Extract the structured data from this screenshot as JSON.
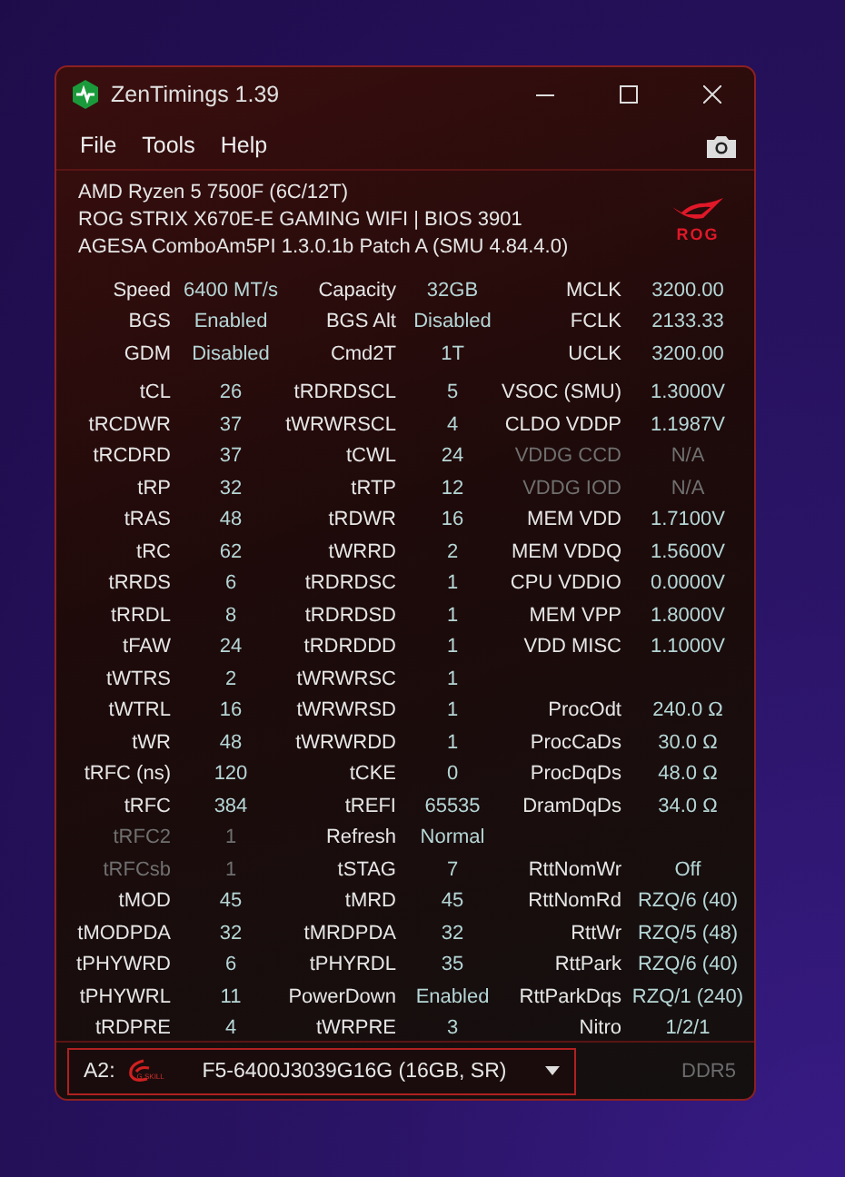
{
  "window": {
    "title": "ZenTimings 1.39"
  },
  "menu": [
    "File",
    "Tools",
    "Help"
  ],
  "system_info": [
    "AMD Ryzen 5 7500F (6C/12T)",
    "ROG STRIX X670E-E GAMING WIFI | BIOS 3901",
    "AGESA ComboAm5PI 1.3.0.1b Patch A (SMU 4.84.4.0)"
  ],
  "brand_logo": {
    "text": "ROG"
  },
  "groups": [
    [
      [
        {
          "label": "Speed",
          "value": "6400 MT/s",
          "disabled": false
        },
        {
          "label": "Capacity",
          "value": "32GB",
          "disabled": false
        },
        {
          "label": "MCLK",
          "value": "3200.00",
          "disabled": false
        }
      ],
      [
        {
          "label": "BGS",
          "value": "Enabled",
          "disabled": false
        },
        {
          "label": "BGS Alt",
          "value": "Disabled",
          "disabled": false
        },
        {
          "label": "FCLK",
          "value": "2133.33",
          "disabled": false
        }
      ],
      [
        {
          "label": "GDM",
          "value": "Disabled",
          "disabled": false
        },
        {
          "label": "Cmd2T",
          "value": "1T",
          "disabled": false
        },
        {
          "label": "UCLK",
          "value": "3200.00",
          "disabled": false
        }
      ]
    ],
    [
      [
        {
          "label": "tCL",
          "value": "26",
          "disabled": false
        },
        {
          "label": "tRDRDSCL",
          "value": "5",
          "disabled": false
        },
        {
          "label": "VSOC (SMU)",
          "value": "1.3000V",
          "disabled": false
        }
      ],
      [
        {
          "label": "tRCDWR",
          "value": "37",
          "disabled": false
        },
        {
          "label": "tWRWRSCL",
          "value": "4",
          "disabled": false
        },
        {
          "label": "CLDO VDDP",
          "value": "1.1987V",
          "disabled": false
        }
      ],
      [
        {
          "label": "tRCDRD",
          "value": "37",
          "disabled": false
        },
        {
          "label": "tCWL",
          "value": "24",
          "disabled": false
        },
        {
          "label": "VDDG CCD",
          "value": "N/A",
          "disabled": true
        }
      ],
      [
        {
          "label": "tRP",
          "value": "32",
          "disabled": false
        },
        {
          "label": "tRTP",
          "value": "12",
          "disabled": false
        },
        {
          "label": "VDDG IOD",
          "value": "N/A",
          "disabled": true
        }
      ],
      [
        {
          "label": "tRAS",
          "value": "48",
          "disabled": false
        },
        {
          "label": "tRDWR",
          "value": "16",
          "disabled": false
        },
        {
          "label": "MEM VDD",
          "value": "1.7100V",
          "disabled": false
        }
      ],
      [
        {
          "label": "tRC",
          "value": "62",
          "disabled": false
        },
        {
          "label": "tWRRD",
          "value": "2",
          "disabled": false
        },
        {
          "label": "MEM VDDQ",
          "value": "1.5600V",
          "disabled": false
        }
      ],
      [
        {
          "label": "tRRDS",
          "value": "6",
          "disabled": false
        },
        {
          "label": "tRDRDSC",
          "value": "1",
          "disabled": false
        },
        {
          "label": "CPU VDDIO",
          "value": "0.0000V",
          "disabled": false
        }
      ],
      [
        {
          "label": "tRRDL",
          "value": "8",
          "disabled": false
        },
        {
          "label": "tRDRDSD",
          "value": "1",
          "disabled": false
        },
        {
          "label": "MEM VPP",
          "value": "1.8000V",
          "disabled": false
        }
      ],
      [
        {
          "label": "tFAW",
          "value": "24",
          "disabled": false
        },
        {
          "label": "tRDRDDD",
          "value": "1",
          "disabled": false
        },
        {
          "label": "VDD MISC",
          "value": "1.1000V",
          "disabled": false
        }
      ],
      [
        {
          "label": "tWTRS",
          "value": "2",
          "disabled": false
        },
        {
          "label": "tWRWRSC",
          "value": "1",
          "disabled": false
        }
      ],
      [
        {
          "label": "tWTRL",
          "value": "16",
          "disabled": false
        },
        {
          "label": "tWRWRSD",
          "value": "1",
          "disabled": false
        },
        {
          "label": "ProcOdt",
          "value": "240.0 Ω",
          "disabled": false
        }
      ],
      [
        {
          "label": "tWR",
          "value": "48",
          "disabled": false
        },
        {
          "label": "tWRWRDD",
          "value": "1",
          "disabled": false
        },
        {
          "label": "ProcCaDs",
          "value": "30.0 Ω",
          "disabled": false
        }
      ],
      [
        {
          "label": "tRFC (ns)",
          "value": "120",
          "disabled": false
        },
        {
          "label": "tCKE",
          "value": "0",
          "disabled": false
        },
        {
          "label": "ProcDqDs",
          "value": "48.0 Ω",
          "disabled": false
        }
      ],
      [
        {
          "label": "tRFC",
          "value": "384",
          "disabled": false
        },
        {
          "label": "tREFI",
          "value": "65535",
          "disabled": false
        },
        {
          "label": "DramDqDs",
          "value": "34.0 Ω",
          "disabled": false
        }
      ],
      [
        {
          "label": "tRFC2",
          "value": "1",
          "disabled": true
        },
        {
          "label": "Refresh",
          "value": "Normal",
          "disabled": false
        }
      ],
      [
        {
          "label": "tRFCsb",
          "value": "1",
          "disabled": true
        },
        {
          "label": "tSTAG",
          "value": "7",
          "disabled": false
        },
        {
          "label": "RttNomWr",
          "value": "Off",
          "disabled": false
        }
      ],
      [
        {
          "label": "tMOD",
          "value": "45",
          "disabled": false
        },
        {
          "label": "tMRD",
          "value": "45",
          "disabled": false
        },
        {
          "label": "RttNomRd",
          "value": "RZQ/6 (40)",
          "disabled": false
        }
      ],
      [
        {
          "label": "tMODPDA",
          "value": "32",
          "disabled": false
        },
        {
          "label": "tMRDPDA",
          "value": "32",
          "disabled": false
        },
        {
          "label": "RttWr",
          "value": "RZQ/5 (48)",
          "disabled": false
        }
      ],
      [
        {
          "label": "tPHYWRD",
          "value": "6",
          "disabled": false
        },
        {
          "label": "tPHYRDL",
          "value": "35",
          "disabled": false
        },
        {
          "label": "RttPark",
          "value": "RZQ/6 (40)",
          "disabled": false
        }
      ],
      [
        {
          "label": "tPHYWRL",
          "value": "11",
          "disabled": false
        },
        {
          "label": "PowerDown",
          "value": "Enabled",
          "disabled": false
        },
        {
          "label": "RttParkDqs",
          "value": "RZQ/1 (240)",
          "disabled": false
        }
      ],
      [
        {
          "label": "tRDPRE",
          "value": "4",
          "disabled": false
        },
        {
          "label": "tWRPRE",
          "value": "3",
          "disabled": false
        },
        {
          "label": "Nitro",
          "value": "1/2/1",
          "disabled": false
        }
      ]
    ]
  ],
  "module_select": {
    "slot": "A2:",
    "logo_text": "G.SKILL",
    "value": "F5-6400J3039G16G (16GB, SR)"
  },
  "memory_type": "DDR5"
}
